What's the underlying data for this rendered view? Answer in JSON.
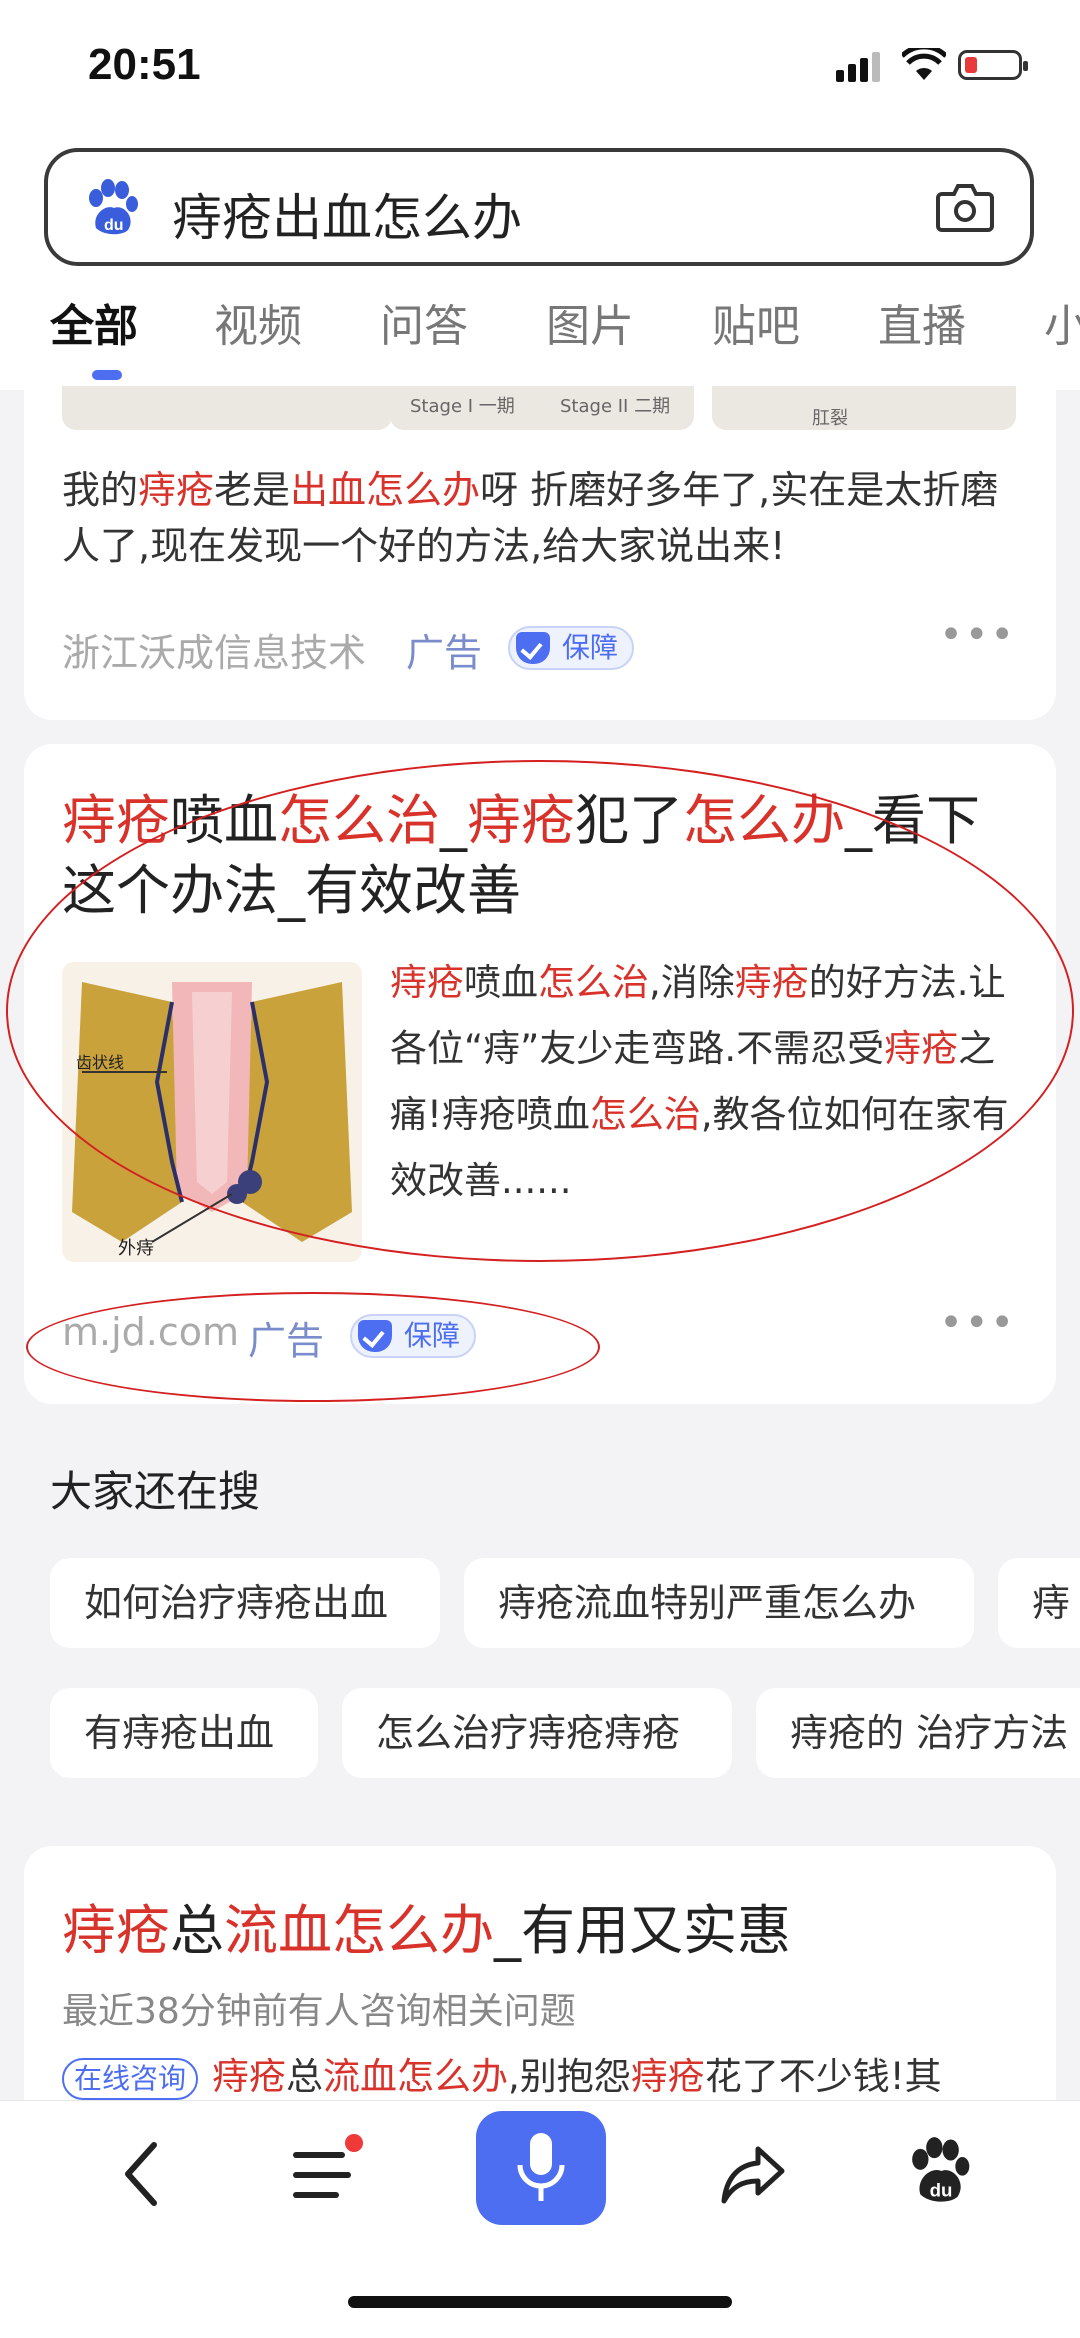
{
  "status": {
    "time": "20:51"
  },
  "search": {
    "query": "痔疮出血怎么办"
  },
  "tabs": [
    "全部",
    "视频",
    "问答",
    "图片",
    "贴吧",
    "直播",
    "小"
  ],
  "ad1": {
    "thumb_labels": [
      "Stage I 一期",
      "Stage II 二期",
      "肛裂"
    ],
    "text_parts": [
      "我的",
      "痔疮",
      "老是",
      "出血怎么办",
      "呀 折磨好多年了,实在是太折磨人了,现在发现一个好的方法,给大家说出来!"
    ],
    "source": "浙江沃成信息技术",
    "ad_label": "广告",
    "badge": "保障"
  },
  "ad2": {
    "title_parts": [
      "痔疮",
      "喷血",
      "怎么治",
      "_",
      "痔疮",
      "犯了",
      "怎么办",
      "_看下这个办法_有效改善"
    ],
    "image_labels": [
      "齿状线",
      "外痔"
    ],
    "desc_parts": [
      "痔疮",
      "喷血",
      "怎么治",
      ",消除",
      "痔疮",
      "的好方法.让各位“痔”友少走弯路.不需忍受",
      "痔疮",
      "之痛!痔疮喷血",
      "怎么治",
      ",教各位如何在家有效改善......"
    ],
    "source": "m.jd.com",
    "ad_label": "广告",
    "badge": "保障"
  },
  "related": {
    "title": "大家还在搜",
    "row1": [
      "如何治疗痔疮出血",
      "痔疮流血特别严重怎么办",
      "痔"
    ],
    "row2": [
      "有痔疮出血",
      "怎么治疗痔疮痔疮",
      "痔疮的 治疗方法"
    ]
  },
  "ad3": {
    "title_parts": [
      "痔疮",
      "总",
      "流血怎么办",
      "_有用又实惠"
    ],
    "subtitle": "最近38分钟前有人咨询相关问题",
    "consult_label": "在线咨询",
    "line_parts": [
      "痔疮",
      "总",
      "流血怎么办",
      ",别抱怨",
      "痔疮",
      "花了不少钱!其"
    ]
  },
  "colors": {
    "highlight": "#d8322b",
    "accent": "#4e6ef2",
    "annotation": "#d42020"
  }
}
